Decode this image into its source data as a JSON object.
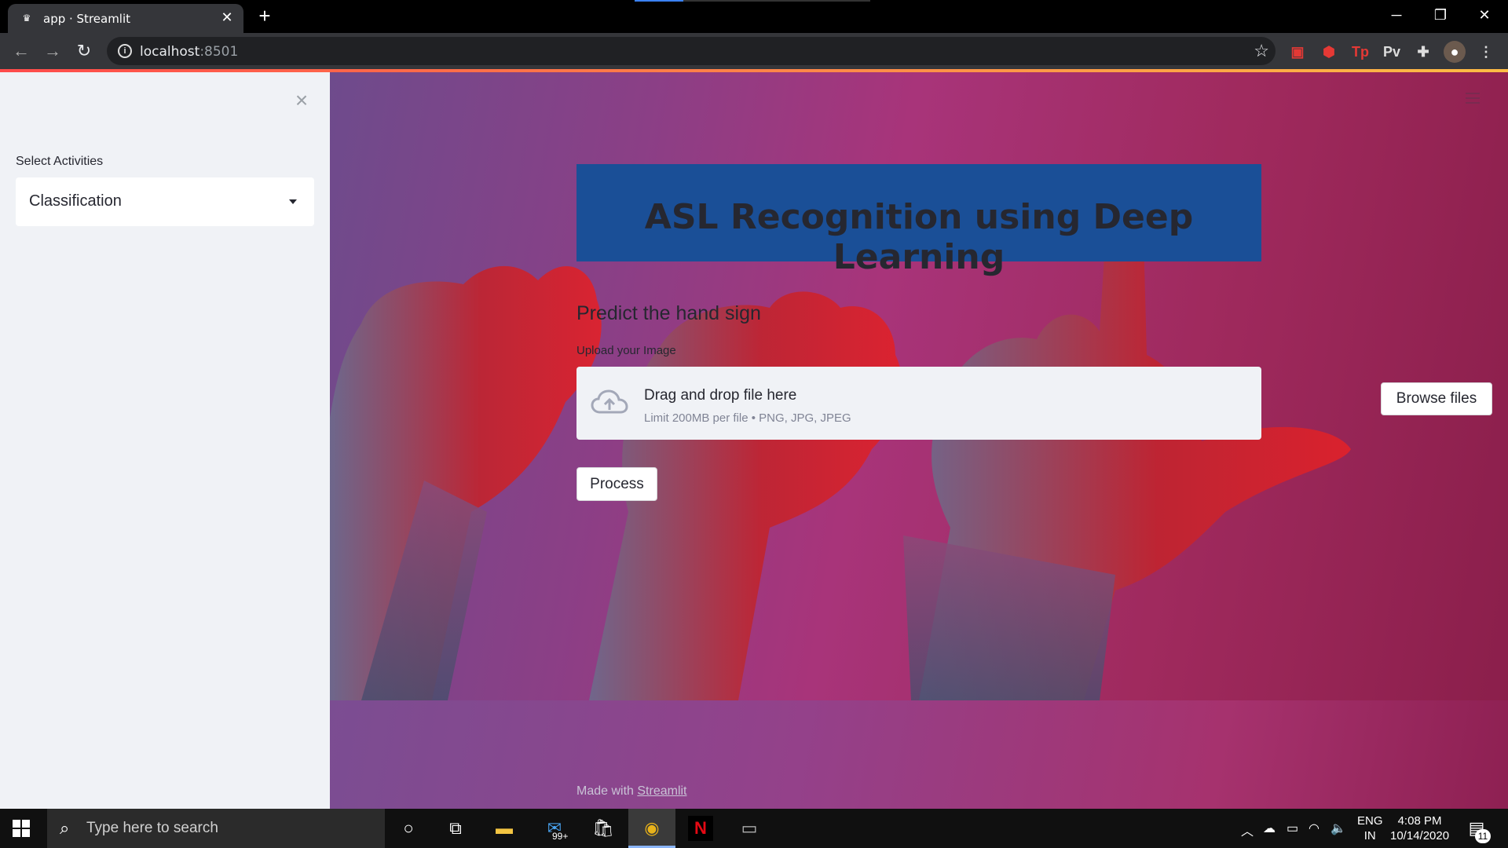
{
  "browser": {
    "tab_title": "app · Streamlit",
    "url_host": "localhost",
    "url_port": ":8501"
  },
  "sidebar": {
    "select_label": "Select Activities",
    "select_value": "Classification"
  },
  "main": {
    "title": "ASL Recognition using Deep Learning",
    "subheader": "Predict the hand sign",
    "upload_label": "Upload your Image",
    "dropzone_title": "Drag and drop file here",
    "dropzone_limit": "Limit 200MB per file • PNG, JPG, JPEG",
    "browse_button": "Browse files",
    "process_button": "Process",
    "footer_prefix": "Made with ",
    "footer_link": "Streamlit"
  },
  "taskbar": {
    "search_placeholder": "Type here to search",
    "mail_badge": "99+",
    "language_line1": "ENG",
    "language_line2": "IN",
    "time": "4:08 PM",
    "date": "10/14/2020",
    "notification_count": "11"
  },
  "extensions": {
    "tp_label": "Tp",
    "pv_label": "Pv"
  },
  "colors": {
    "title_box": "#1a4f97",
    "sidebar_bg": "#f0f2f6",
    "accent_gradient_start": "#ff4b4b",
    "accent_gradient_end": "#ffbd45"
  }
}
